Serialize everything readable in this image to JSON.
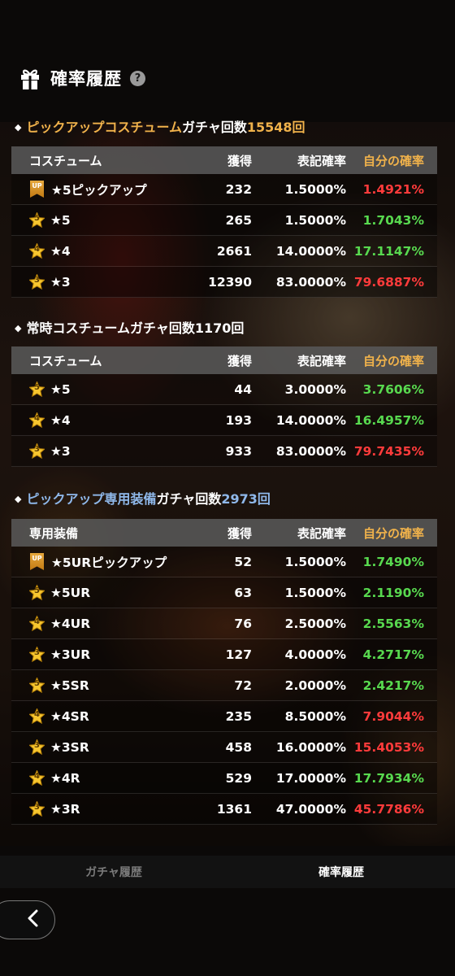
{
  "header": {
    "title": "確率履歴",
    "help": "?"
  },
  "columns": {
    "get": "獲得",
    "rate": "表記確率",
    "mine": "自分の確率"
  },
  "sections": [
    {
      "title_prefix": "ピックアップコスチューム",
      "title_suffix": "ガチャ回数",
      "count": "15548回",
      "category": "コスチューム",
      "rows": [
        {
          "badge": "UP",
          "name": "★5ピックアップ",
          "get": "232",
          "rate": "1.5000%",
          "mine": "1.4921%",
          "mine_color": "red"
        },
        {
          "badge": "5",
          "name": "★5",
          "get": "265",
          "rate": "1.5000%",
          "mine": "1.7043%",
          "mine_color": "green"
        },
        {
          "badge": "4",
          "name": "★4",
          "get": "2661",
          "rate": "14.0000%",
          "mine": "17.1147%",
          "mine_color": "green"
        },
        {
          "badge": "3",
          "name": "★3",
          "get": "12390",
          "rate": "83.0000%",
          "mine": "79.6887%",
          "mine_color": "red"
        }
      ]
    },
    {
      "title_prefix": "常時コスチューム",
      "title_suffix": "ガチャ回数",
      "count": "1170回",
      "category": "コスチューム",
      "rows": [
        {
          "badge": "5",
          "name": "★5",
          "get": "44",
          "rate": "3.0000%",
          "mine": "3.7606%",
          "mine_color": "green"
        },
        {
          "badge": "4",
          "name": "★4",
          "get": "193",
          "rate": "14.0000%",
          "mine": "16.4957%",
          "mine_color": "green"
        },
        {
          "badge": "3",
          "name": "★3",
          "get": "933",
          "rate": "83.0000%",
          "mine": "79.7435%",
          "mine_color": "red"
        }
      ]
    },
    {
      "title_prefix": "ピックアップ専用装備",
      "title_suffix": "ガチャ回数",
      "count": "2973回",
      "category": "専用装備",
      "rows": [
        {
          "badge": "UP",
          "name": "★5URピックアップ",
          "get": "52",
          "rate": "1.5000%",
          "mine": "1.7490%",
          "mine_color": "green"
        },
        {
          "badge": "5",
          "name": "★5UR",
          "get": "63",
          "rate": "1.5000%",
          "mine": "2.1190%",
          "mine_color": "green"
        },
        {
          "badge": "4",
          "name": "★4UR",
          "get": "76",
          "rate": "2.5000%",
          "mine": "2.5563%",
          "mine_color": "green"
        },
        {
          "badge": "3",
          "name": "★3UR",
          "get": "127",
          "rate": "4.0000%",
          "mine": "4.2717%",
          "mine_color": "green"
        },
        {
          "badge": "5",
          "name": "★5SR",
          "get": "72",
          "rate": "2.0000%",
          "mine": "2.4217%",
          "mine_color": "green"
        },
        {
          "badge": "4",
          "name": "★4SR",
          "get": "235",
          "rate": "8.5000%",
          "mine": "7.9044%",
          "mine_color": "red"
        },
        {
          "badge": "3",
          "name": "★3SR",
          "get": "458",
          "rate": "16.0000%",
          "mine": "15.4053%",
          "mine_color": "red"
        },
        {
          "badge": "4",
          "name": "★4R",
          "get": "529",
          "rate": "17.0000%",
          "mine": "17.7934%",
          "mine_color": "green"
        },
        {
          "badge": "3",
          "name": "★3R",
          "get": "1361",
          "rate": "47.0000%",
          "mine": "45.7786%",
          "mine_color": "red"
        }
      ]
    }
  ],
  "tabs": [
    {
      "label": "ガチャ履歴",
      "active": false
    },
    {
      "label": "確率履歴",
      "active": true
    }
  ],
  "colors": {
    "gold": "#f0b24b",
    "blue": "#8fb8ea",
    "red": "#ff3b3b",
    "green": "#58d94f"
  },
  "icons": {
    "header": "gift-icon",
    "help": "help-icon",
    "back": "back-arrow-icon",
    "star": "star-badge-icon",
    "up": "pickup-up-badge-icon"
  }
}
